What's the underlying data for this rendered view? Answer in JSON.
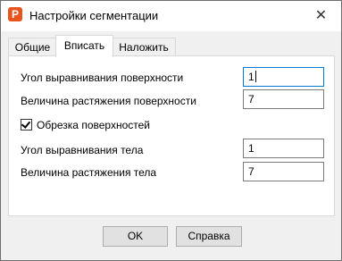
{
  "window": {
    "title": "Настройки сегментации",
    "app_icon_letter": "P",
    "app_icon_color": "#e8541e",
    "close_symbol": "✕"
  },
  "tabs": [
    {
      "label": "Общие",
      "active": false
    },
    {
      "label": "Вписать",
      "active": true
    },
    {
      "label": "Наложить",
      "active": false
    }
  ],
  "form": {
    "surface_angle_label": "Угол выравнивания поверхности",
    "surface_angle_value": "1",
    "surface_stretch_label": "Величина растяжения поверхности",
    "surface_stretch_value": "7",
    "trim_surfaces_label": "Обрезка поверхностей",
    "trim_surfaces_checked": true,
    "body_angle_label": "Угол выравнивания тела",
    "body_angle_value": "1",
    "body_stretch_label": "Величина растяжения тела",
    "body_stretch_value": "7"
  },
  "buttons": {
    "ok": "OK",
    "help": "Справка"
  }
}
